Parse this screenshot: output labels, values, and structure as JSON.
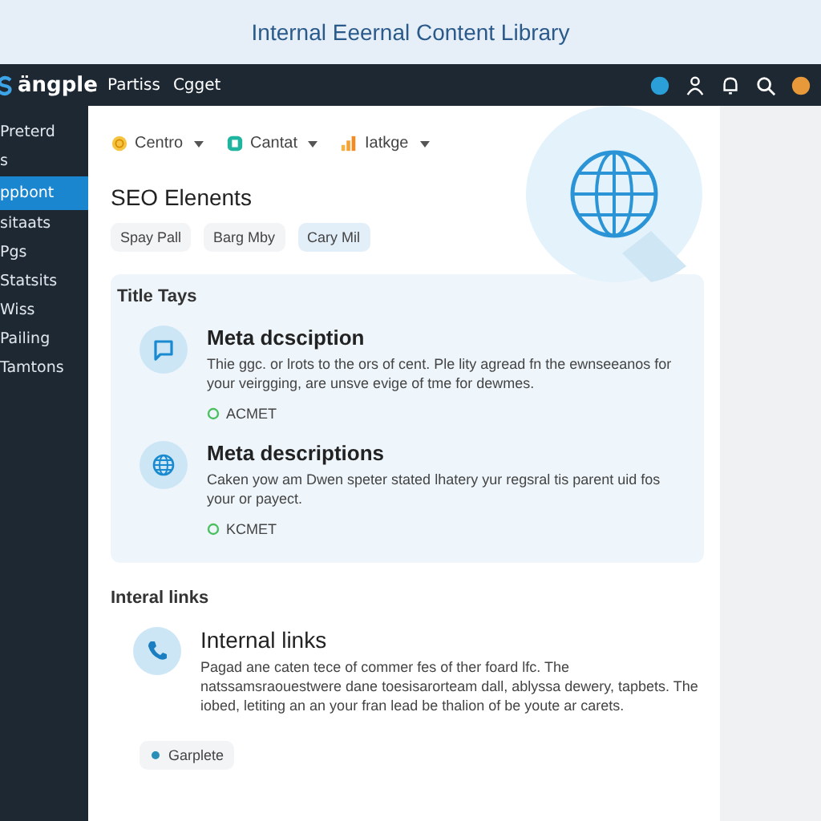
{
  "window": {
    "title": "Internal Eeernal Content Library"
  },
  "navbar": {
    "logo": "ängple",
    "links": [
      "Partiss",
      "Cgget"
    ]
  },
  "sidebar": {
    "items": [
      {
        "label": "Preterd",
        "selected": false
      },
      {
        "label": "s",
        "selected": false
      },
      {
        "label": "ppbont",
        "selected": true
      },
      {
        "label": "sitaats",
        "selected": false
      },
      {
        "label": "Pgs",
        "selected": false
      },
      {
        "label": "Statsits",
        "selected": false
      },
      {
        "label": "Wiss",
        "selected": false
      },
      {
        "label": "Pailing",
        "selected": false
      },
      {
        "label": "Tamtons",
        "selected": false
      }
    ]
  },
  "filters": [
    {
      "label": "Centro",
      "kind": "clock"
    },
    {
      "label": "Cantat",
      "kind": "badge"
    },
    {
      "label": "Iatkge",
      "kind": "bars"
    }
  ],
  "section_title": "SEO Elenents",
  "chips": [
    {
      "label": "Spay Pall",
      "selected": false
    },
    {
      "label": "Barg Mby",
      "selected": false
    },
    {
      "label": "Cary Mil",
      "selected": true
    }
  ],
  "title_tags": {
    "heading": "Title Tays",
    "items": [
      {
        "title": "Meta dcsciption",
        "text": "Thie ggc. or lrots to the ors of cent. Ple lity agread fn the ewnseeanos for your veirgging, are unsve evige of tme for dewmes.",
        "status": "ACMET"
      },
      {
        "title": "Meta descriptions",
        "text": "Caken yow am Dwen speter stated lhatery yur regsral tis parent uid fos your or payect.",
        "status": "KCMET"
      }
    ]
  },
  "internal_links": {
    "heading": "Interal links",
    "items": [
      {
        "title": "Internal links",
        "text": "Pagad ane caten tece of commer fes of ther foard lfc. The natssamsraouestwere dane toesisarorteam dall, ablyssa dewery, tapbets. The iobed, letiting an an your fran lead be thalion of be youte ar carets."
      }
    ],
    "chip": "Garplete"
  }
}
